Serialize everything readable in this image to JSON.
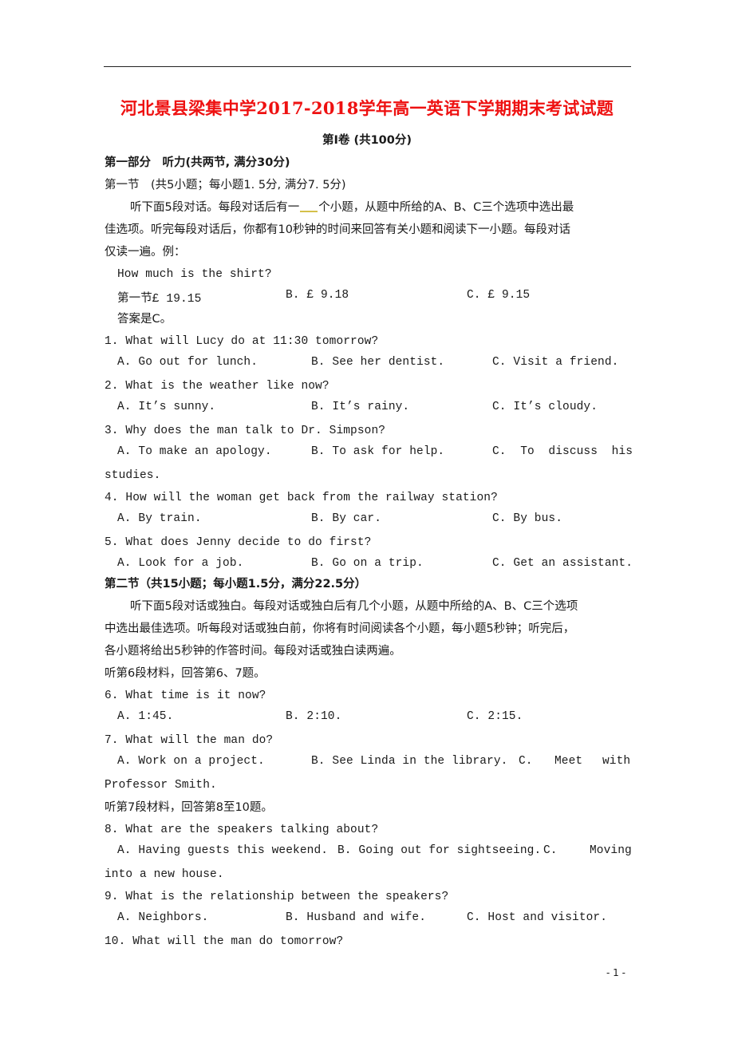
{
  "document": {
    "title": "河北景县梁集中学2017-2018学年高一英语下学期期末考试试题",
    "volume_heading": "第I卷 (共100分)",
    "page_number": "- 1 -",
    "colors": {
      "title": "#ee1111",
      "blank_underline": "#d4c04a"
    }
  },
  "part1": {
    "heading": "第一部分　听力(共两节, 满分30分)",
    "section1": {
      "heading": "第一节　(共5小题；每小题1. 5分, 满分7. 5分)",
      "instructions_line1_before": "听下面5段对话。每段对话后有一",
      "instructions_line1_after": "个小题，从题中所给的A、B、C三个选项中选出最",
      "instructions_line2": "佳选项。听完每段对话后，你都有10秒钟的时间来回答有关小题和阅读下一小题。每段对话",
      "instructions_line3": "仅读一遍。例：",
      "example": {
        "question": "How much is the shirt?",
        "options": [
          "第一节£ 19.15",
          "B. £ 9.18",
          "C. £ 9.15"
        ],
        "answer": "答案是C。"
      },
      "questions": [
        {
          "q": "1. What will Lucy do at 11:30 tomorrow?",
          "options": [
            "A. Go out for lunch.",
            "B. See her dentist.",
            "C. Visit a friend."
          ]
        },
        {
          "q": "2. What is the weather like now?",
          "options": [
            "A. It’s sunny.",
            "B. It’s rainy.",
            "C. It’s cloudy."
          ]
        },
        {
          "q": "3. Why does the man talk to Dr. Simpson?",
          "options": [
            "A. To make an apology.",
            "B. To ask for help.",
            "C.  To  discuss  his"
          ],
          "continuation": "studies."
        },
        {
          "q": "4. How will the woman get back from the railway station?",
          "options": [
            "A. By train.",
            "B. By car.",
            "C. By bus."
          ]
        },
        {
          "q": "5. What does Jenny decide to do first?",
          "options": [
            "A. Look for a job.",
            "B. Go on a trip.",
            "C. Get an assistant."
          ]
        }
      ]
    },
    "section2": {
      "heading": "第二节（共15小题；每小题1.5分，满分22.5分）",
      "instructions_line1": "听下面5段对话或独白。每段对话或独白后有几个小题，从题中所给的A、B、C三个选项",
      "instructions_line2": "中选出最佳选项。听每段对话或独白前，你将有时间阅读各个小题，每小题5秒钟；听完后，",
      "instructions_line3": "各小题将给出5秒钟的作答时间。每段对话或独白读两遍。",
      "material6": "听第6段材料，回答第6、7题。",
      "material7": "听第7段材料，回答第8至10题。",
      "questions": [
        {
          "q": "6. What time is it now?",
          "options": [
            "A. 1:45.",
            "B. 2:10.",
            "C. 2:15."
          ]
        },
        {
          "q": "7. What will the man do?",
          "options": [
            "A. Work on a project.",
            "B. See Linda in the library.",
            "C.",
            "Meet",
            "with"
          ],
          "continuation": "Professor Smith."
        },
        {
          "q": "8. What are the speakers talking about?",
          "options": [
            "A. Having guests this weekend.",
            "B. Going out for sightseeing.",
            "C.",
            "Moving"
          ],
          "continuation": "into a new house."
        },
        {
          "q": "9. What is the relationship between the speakers?",
          "options": [
            "A. Neighbors.",
            "B. Husband and wife.",
            "C. Host and visitor."
          ]
        },
        {
          "q": "10. What will the man do tomorrow?"
        }
      ]
    }
  }
}
